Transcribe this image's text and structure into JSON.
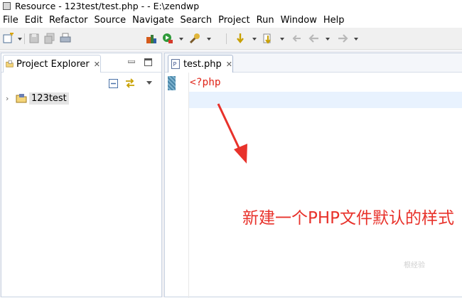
{
  "window": {
    "title": "Resource - 123test/test.php -  - E:\\zendwp"
  },
  "menu": [
    "File",
    "Edit",
    "Refactor",
    "Source",
    "Navigate",
    "Search",
    "Project",
    "Run",
    "Window",
    "Help"
  ],
  "explorer": {
    "tab_label": "Project Explorer",
    "project_name": "123test"
  },
  "editor": {
    "tab_label": "test.php",
    "code": "<?php"
  },
  "annotation": {
    "text": "新建一个PHP文件默认的样式",
    "color": "#e8322b"
  },
  "watermark": "根经验",
  "colors": {
    "code_tag": "#e0261a",
    "current_line": "#e8f2fe",
    "toolbar_bg": "#f0f0f0"
  }
}
